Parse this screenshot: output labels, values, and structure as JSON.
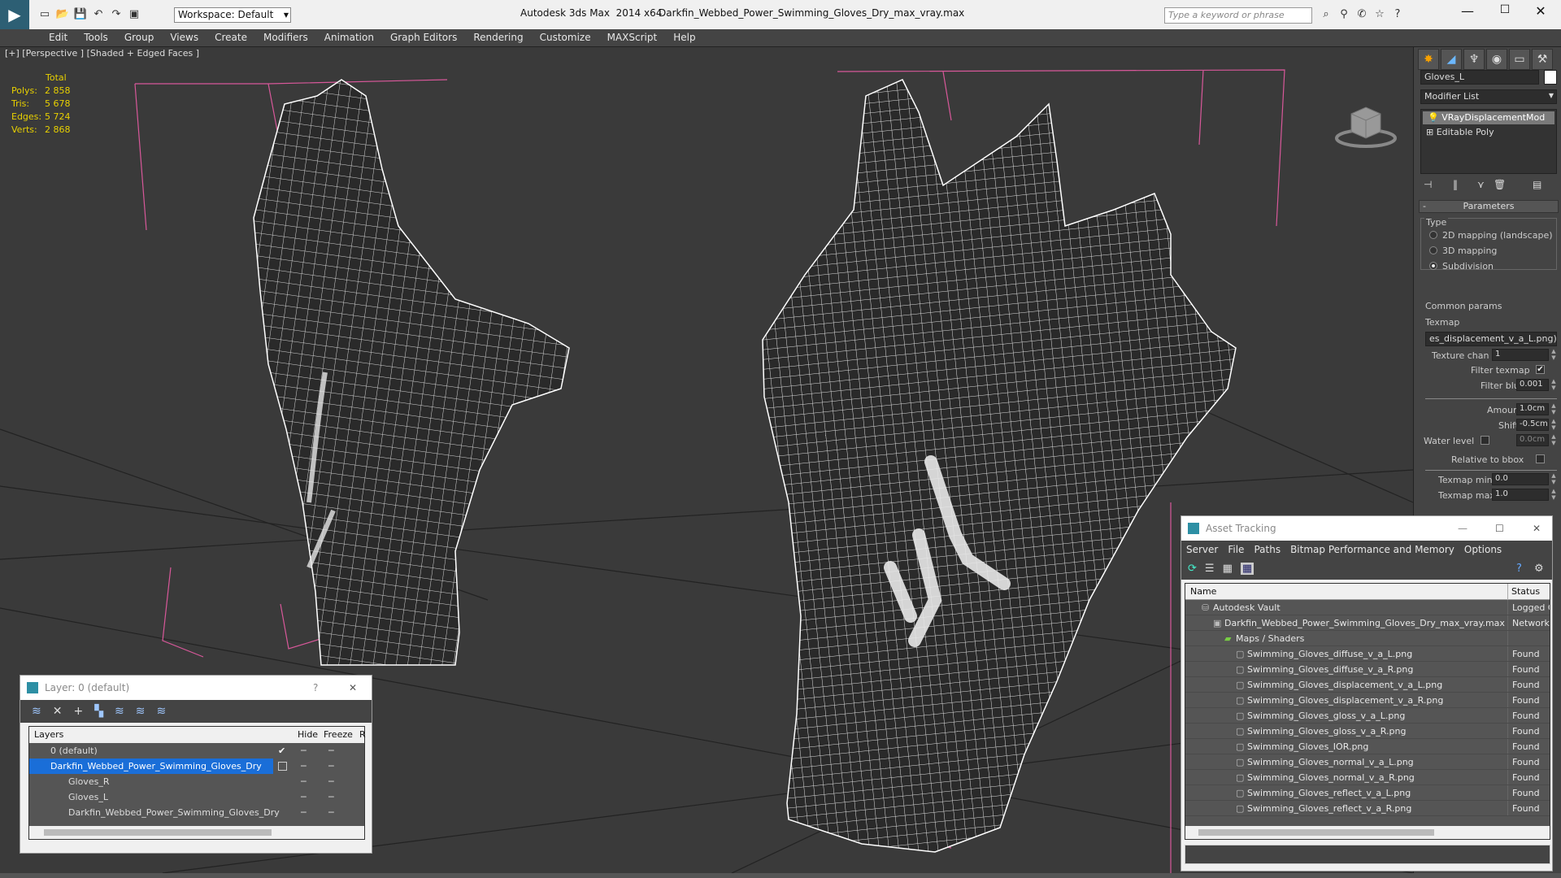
{
  "titlebar": {
    "workspace": "Workspace: Default",
    "app_title": "Autodesk 3ds Max  2014 x64",
    "file_title": "Darkfin_Webbed_Power_Swimming_Gloves_Dry_max_vray.max",
    "search_placeholder": "Type a keyword or phrase"
  },
  "menu": [
    "Edit",
    "Tools",
    "Group",
    "Views",
    "Create",
    "Modifiers",
    "Animation",
    "Graph Editors",
    "Rendering",
    "Customize",
    "MAXScript",
    "Help"
  ],
  "viewport": {
    "label": "[+] [Perspective ] [Shaded + Edged Faces ]",
    "stats": {
      "header": "Total",
      "rows": [
        {
          "k": "Polys:",
          "v": "2 858"
        },
        {
          "k": "Tris:",
          "v": "5 678"
        },
        {
          "k": "Edges:",
          "v": "5 724"
        },
        {
          "k": "Verts:",
          "v": "2 868"
        }
      ]
    },
    "colors": {
      "bg": "#3a3a3a",
      "wire": "#ffffff",
      "bbox": "#d8589a",
      "stats": "#e8d000"
    }
  },
  "cmdpanel": {
    "object_name": "Gloves_L",
    "modifier_list": "Modifier List",
    "stack": [
      "VRayDisplacementMod",
      "Editable Poly"
    ],
    "rollout_title": "Parameters",
    "type_label": "Type",
    "type_options": [
      {
        "label": "2D mapping (landscape)",
        "on": false
      },
      {
        "label": "3D mapping",
        "on": false
      },
      {
        "label": "Subdivision",
        "on": true
      }
    ],
    "common_params": "Common params",
    "texmap_label": "Texmap",
    "texmap_value": "es_displacement_v_a_L.png)",
    "texture_chan_label": "Texture chan",
    "texture_chan": "1",
    "filter_texmap_label": "Filter texmap",
    "filter_blur_label": "Filter blur",
    "filter_blur": "0.001",
    "amount_label": "Amount",
    "amount": "1.0cm",
    "shift_label": "Shift",
    "shift": "-0.5cm",
    "water_label": "Water level",
    "water": "0.0cm",
    "relative_label": "Relative to bbox",
    "texmap_min_label": "Texmap min",
    "texmap_min": "0.0",
    "texmap_max_label": "Texmap max",
    "texmap_max": "1.0"
  },
  "layer_window": {
    "title": "Layer: 0 (default)",
    "help": "?",
    "col_layers": "Layers",
    "col_hide": "Hide",
    "col_freeze": "Freeze",
    "col_r": "R",
    "rows": [
      {
        "name": "0 (default)",
        "check": "✔"
      },
      {
        "name": "Darkfin_Webbed_Power_Swimming_Gloves_Dry",
        "check": ""
      },
      {
        "name": "Gloves_R",
        "check": ""
      },
      {
        "name": "Gloves_L",
        "check": ""
      },
      {
        "name": "Darkfin_Webbed_Power_Swimming_Gloves_Dry",
        "check": ""
      }
    ]
  },
  "asset_window": {
    "title": "Asset Tracking",
    "menu": [
      "Server",
      "File",
      "Paths",
      "Bitmap Performance and Memory",
      "Options"
    ],
    "col_name": "Name",
    "col_status": "Status",
    "rows": [
      {
        "name": "Autodesk Vault",
        "status": "Logged O"
      },
      {
        "name": "Darkfin_Webbed_Power_Swimming_Gloves_Dry_max_vray.max",
        "status": "Network I"
      },
      {
        "name": "Maps / Shaders",
        "status": ""
      },
      {
        "name": "Swimming_Gloves_diffuse_v_a_L.png",
        "status": "Found"
      },
      {
        "name": "Swimming_Gloves_diffuse_v_a_R.png",
        "status": "Found"
      },
      {
        "name": "Swimming_Gloves_displacement_v_a_L.png",
        "status": "Found"
      },
      {
        "name": "Swimming_Gloves_displacement_v_a_R.png",
        "status": "Found"
      },
      {
        "name": "Swimming_Gloves_gloss_v_a_L.png",
        "status": "Found"
      },
      {
        "name": "Swimming_Gloves_gloss_v_a_R.png",
        "status": "Found"
      },
      {
        "name": "Swimming_Gloves_IOR.png",
        "status": "Found"
      },
      {
        "name": "Swimming_Gloves_normal_v_a_L.png",
        "status": "Found"
      },
      {
        "name": "Swimming_Gloves_normal_v_a_R.png",
        "status": "Found"
      },
      {
        "name": "Swimming_Gloves_reflect_v_a_L.png",
        "status": "Found"
      },
      {
        "name": "Swimming_Gloves_reflect_v_a_R.png",
        "status": "Found"
      }
    ]
  }
}
